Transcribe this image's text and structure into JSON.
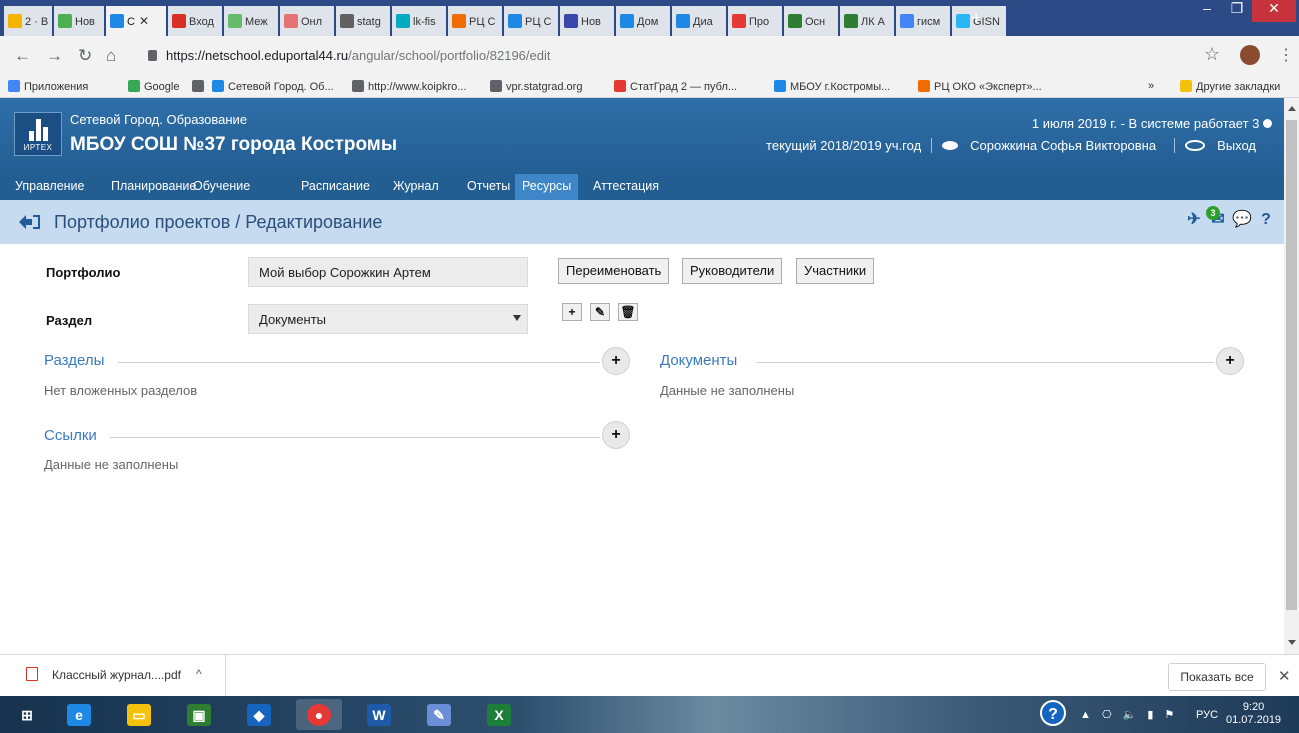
{
  "browser": {
    "tabs": [
      {
        "label": "2 · В",
        "color": "#f4b400",
        "active": false
      },
      {
        "label": "Нов",
        "color": "#4caf50",
        "active": false
      },
      {
        "label": "С",
        "color": "#1e88e5",
        "active": true,
        "close": "✕"
      },
      {
        "label": "Вход",
        "color": "#d93025",
        "active": false
      },
      {
        "label": "Меж",
        "color": "#66bb6a",
        "active": false
      },
      {
        "label": "Онл",
        "color": "#e57373",
        "active": false
      },
      {
        "label": "statg",
        "color": "#616161",
        "active": false
      },
      {
        "label": "lk-fis",
        "color": "#00acc1",
        "active": false
      },
      {
        "label": "РЦ С",
        "color": "#ef6c00",
        "active": false
      },
      {
        "label": "РЦ С",
        "color": "#1e88e5",
        "active": false
      },
      {
        "label": "Нов",
        "color": "#3949ab",
        "active": false
      },
      {
        "label": "Дом",
        "color": "#1e88e5",
        "active": false
      },
      {
        "label": "Диа",
        "color": "#1e88e5",
        "active": false
      },
      {
        "label": "Про",
        "color": "#e53935",
        "active": false
      },
      {
        "label": "Осн",
        "color": "#2e7d32",
        "active": false
      },
      {
        "label": "ЛК А",
        "color": "#2e7d32",
        "active": false
      },
      {
        "label": "гисм",
        "color": "#4285f4",
        "active": false
      },
      {
        "label": "GISN",
        "color": "#29b6f6",
        "active": false
      }
    ],
    "new_tab": "+",
    "url_host": "https://netschool.eduportal44.ru",
    "url_path": "/angular/school/portfolio/82196/edit",
    "bookmarks": [
      {
        "label": "Приложения",
        "color": "#4285f4"
      },
      {
        "label": "Google",
        "color": "#34a853"
      },
      {
        "label": "",
        "color": "#5f6368"
      },
      {
        "label": "Сетевой Город. Об...",
        "color": "#1e88e5"
      },
      {
        "label": "http://www.koipkro...",
        "color": "#5f6368"
      },
      {
        "label": "vpr.statgrad.org",
        "color": "#5f6368"
      },
      {
        "label": "СтатГрад 2 — публ...",
        "color": "#e53935"
      },
      {
        "label": "МБОУ г.Костромы...",
        "color": "#1e88e5"
      },
      {
        "label": "РЦ ОКО «Эксперт»...",
        "color": "#ef6c00"
      }
    ],
    "bookmarks_more": "»",
    "other_bookmarks": "Другие закладки"
  },
  "header": {
    "subtitle": "Сетевой Город. Образование",
    "title": "МБОУ СОШ №37 города Костромы",
    "brand": "ИРТЕХ",
    "date_line": "1 июля 2019 г. - В системе работает 3",
    "year": "текущий 2018/2019 уч.год",
    "user": "Сорожкина Софья Викторовна",
    "logout": "Выход"
  },
  "menu": [
    "Управление",
    "Планирование",
    "Обучение",
    "Расписание",
    "Журнал",
    "Отчеты",
    "Ресурсы",
    "Аттестация"
  ],
  "menu_active": "Ресурсы",
  "page": {
    "title": "Портфолио проектов / Редактирование",
    "messages_badge": "3"
  },
  "form": {
    "portfolio_label": "Портфолио",
    "portfolio_value": "Мой выбор Сорожкин Артем",
    "rename_button": "Переименовать",
    "managers_button": "Руководители",
    "participants_button": "Участники",
    "section_label": "Раздел",
    "section_value": "Документы"
  },
  "sections": {
    "sections_title": "Разделы",
    "sections_empty": "Нет вложенных разделов",
    "links_title": "Ссылки",
    "links_empty": "Данные не заполнены",
    "docs_title": "Документы",
    "docs_empty": "Данные не заполнены"
  },
  "downloads": {
    "file": "Классный журнал....pdf",
    "show_all": "Показать все"
  },
  "taskbar": {
    "lang": "РУС",
    "time": "9:20",
    "date": "01.07.2019"
  }
}
